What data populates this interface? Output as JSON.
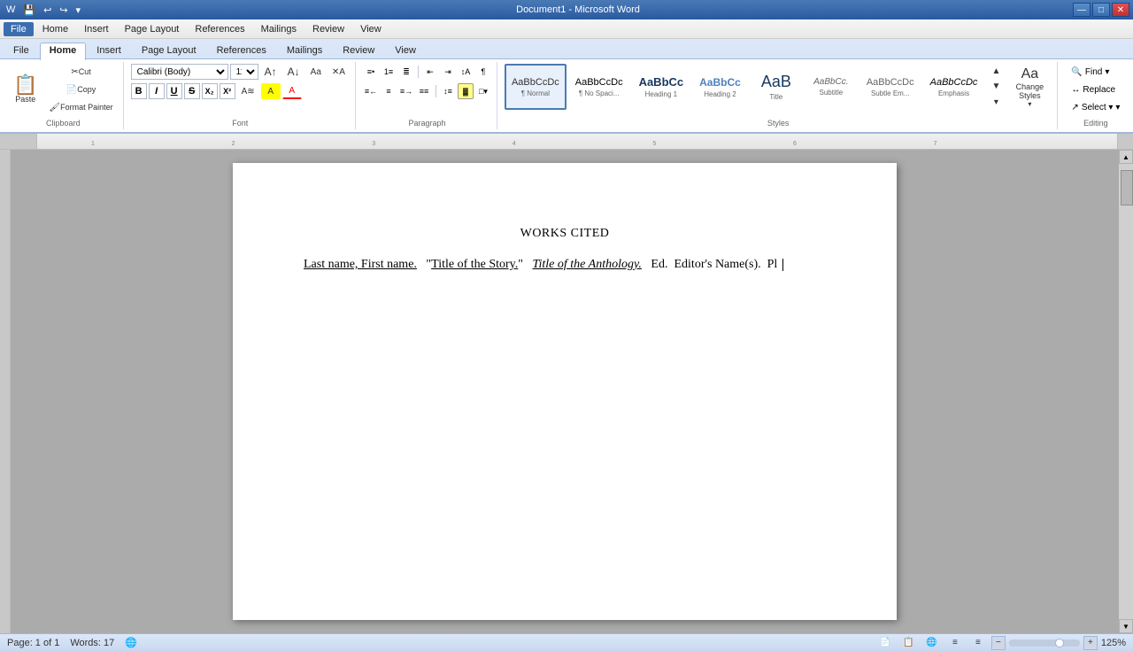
{
  "titlebar": {
    "title": "Document1 - Microsoft Word",
    "quick_access": [
      "💾",
      "↩",
      "↪"
    ],
    "controls": [
      "—",
      "□",
      "✕"
    ]
  },
  "menubar": {
    "items": [
      "File",
      "Home",
      "Insert",
      "Page Layout",
      "References",
      "Mailings",
      "Review",
      "View"
    ],
    "active": "Home"
  },
  "ribbon": {
    "tabs": [
      "File",
      "Home",
      "Insert",
      "Page Layout",
      "References",
      "Mailings",
      "Review",
      "View"
    ],
    "active_tab": "Home",
    "clipboard": {
      "label": "Clipboard",
      "paste_label": "Paste",
      "cut_label": "Cut",
      "copy_label": "Copy",
      "format_painter_label": "Format Painter"
    },
    "font": {
      "label": "Font",
      "font_name": "Calibri (Body)",
      "font_size": "11",
      "bold": "B",
      "italic": "I",
      "underline": "U",
      "strikethrough": "abc",
      "subscript": "x₂",
      "superscript": "x²",
      "clear_format": "A",
      "highlight": "A",
      "font_color": "A"
    },
    "paragraph": {
      "label": "Paragraph"
    },
    "styles": {
      "label": "Styles",
      "items": [
        {
          "name": "1 Normal",
          "preview": "AaBbCcDc",
          "active": true
        },
        {
          "name": "1 No Spaci...",
          "preview": "AaBbCcDc",
          "active": false
        },
        {
          "name": "Heading 1",
          "preview": "AaBbCc",
          "active": false
        },
        {
          "name": "Heading 2",
          "preview": "AaBbCc",
          "active": false
        },
        {
          "name": "Title",
          "preview": "AaB",
          "active": false
        },
        {
          "name": "Subtitle",
          "preview": "AaBbCc.",
          "active": false
        },
        {
          "name": "Subtle Em...",
          "preview": "AaBbCcDc",
          "active": false
        },
        {
          "name": "Emphasis",
          "preview": "AaBbCcDc",
          "active": false
        }
      ],
      "change_styles_label": "Change\nStyles"
    },
    "editing": {
      "label": "Editing",
      "find_label": "Find",
      "replace_label": "Replace",
      "select_label": "Select ▾"
    }
  },
  "document": {
    "title": "WORKS CITED",
    "citation": "Last name, First name.  \"Title of the Story.\"  Title of the Anthology.  Ed.  Editor's Name(s).  Pl"
  },
  "statusbar": {
    "page": "Page: 1 of 1",
    "words": "Words: 17",
    "language_icon": "🌐",
    "view_icons": [
      "📄",
      "📋",
      "📑"
    ],
    "zoom_minus": "−",
    "zoom_plus": "+",
    "zoom_level": "125%"
  }
}
